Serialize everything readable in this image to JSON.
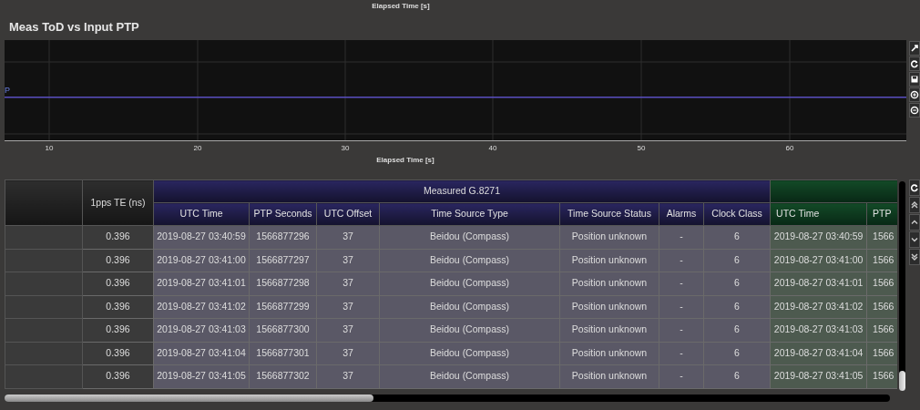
{
  "previous_chart": {
    "xlabel": "Elapsed Time [s]"
  },
  "chart": {
    "title": "Meas ToD vs Input PTP",
    "legend_fragment": "P",
    "x_tick_labels": [
      "10",
      "20",
      "30",
      "40",
      "50",
      "60"
    ],
    "xlabel": "Elapsed Time [s]"
  },
  "chart_toolbar": [
    {
      "kind": "resize"
    },
    {
      "kind": "refresh"
    },
    {
      "kind": "save"
    },
    {
      "kind": "zoom-in"
    },
    {
      "kind": "zoom-out"
    }
  ],
  "table": {
    "group_header": "Measured G.8271",
    "columns": [
      {
        "kind": "blank"
      },
      {
        "kind": "single",
        "label": "1pps TE (ns)"
      },
      {
        "kind": "measured",
        "label": "UTC Time"
      },
      {
        "kind": "measured",
        "label": "PTP Seconds"
      },
      {
        "kind": "measured",
        "label": "UTC Offset"
      },
      {
        "kind": "measured",
        "label": "Time Source Type"
      },
      {
        "kind": "measured",
        "label": "Time Source Status"
      },
      {
        "kind": "measured",
        "label": "Alarms"
      },
      {
        "kind": "measured",
        "label": "Clock Class"
      },
      {
        "kind": "reference",
        "label": "UTC Time"
      },
      {
        "kind": "reference",
        "label": "PTP"
      }
    ],
    "rows": [
      {
        "cells": [
          "",
          "0.396",
          "2019-08-27 03:40:59",
          "1566877296",
          "37",
          "Beidou (Compass)",
          "Position unknown",
          "-",
          "6",
          "2019-08-27 03:40:59",
          "1566"
        ]
      },
      {
        "cells": [
          "",
          "0.396",
          "2019-08-27 03:41:00",
          "1566877297",
          "37",
          "Beidou (Compass)",
          "Position unknown",
          "-",
          "6",
          "2019-08-27 03:41:00",
          "1566"
        ]
      },
      {
        "cells": [
          "",
          "0.396",
          "2019-08-27 03:41:01",
          "1566877298",
          "37",
          "Beidou (Compass)",
          "Position unknown",
          "-",
          "6",
          "2019-08-27 03:41:01",
          "1566"
        ]
      },
      {
        "cells": [
          "",
          "0.396",
          "2019-08-27 03:41:02",
          "1566877299",
          "37",
          "Beidou (Compass)",
          "Position unknown",
          "-",
          "6",
          "2019-08-27 03:41:02",
          "1566"
        ]
      },
      {
        "cells": [
          "",
          "0.396",
          "2019-08-27 03:41:03",
          "1566877300",
          "37",
          "Beidou (Compass)",
          "Position unknown",
          "-",
          "6",
          "2019-08-27 03:41:03",
          "1566"
        ]
      },
      {
        "cells": [
          "",
          "0.396",
          "2019-08-27 03:41:04",
          "1566877301",
          "37",
          "Beidou (Compass)",
          "Position unknown",
          "-",
          "6",
          "2019-08-27 03:41:04",
          "1566"
        ]
      },
      {
        "cells": [
          "",
          "0.396",
          "2019-08-27 03:41:05",
          "1566877302",
          "37",
          "Beidou (Compass)",
          "Position unknown",
          "-",
          "6",
          "2019-08-27 03:41:05",
          "1566"
        ]
      }
    ]
  },
  "table_toolbar": [
    {
      "kind": "refresh"
    },
    {
      "kind": "first"
    },
    {
      "kind": "up"
    },
    {
      "kind": "down"
    },
    {
      "kind": "last"
    }
  ]
}
